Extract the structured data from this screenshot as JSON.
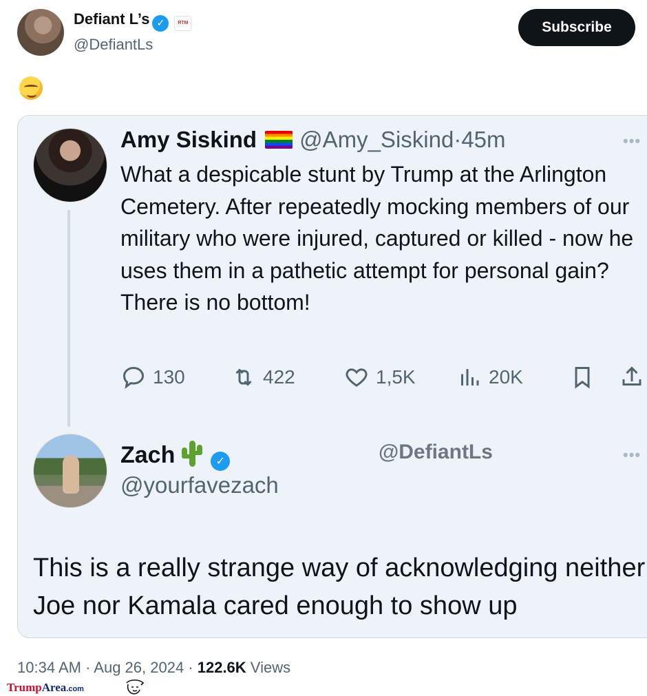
{
  "author": {
    "name": "Defiant L’s",
    "handle": "@DefiantLs",
    "badge": "RTM",
    "subscribe_label": "Subscribe",
    "tweet_emoji": "smirking-face-icon"
  },
  "quoted_tweet": {
    "name": "Amy Siskind",
    "flag_icon": "rainbow-flag-icon",
    "handle": "@Amy_Siskind",
    "separator": "·",
    "time": "45m",
    "text": "What a despicable stunt by Trump at the Arlington Cemetery. After repeatedly mocking members of our military who were injured, captured or killed - now he uses them in a pathetic attempt for personal gain? There is no bottom!",
    "stats": {
      "replies": "130",
      "retweets": "422",
      "likes": "1,5K",
      "views": "20K"
    }
  },
  "reply_tweet": {
    "name": "Zach",
    "emoji": "cactus-icon",
    "handle": "@yourfavezach",
    "overlay_handle": "@DefiantLs",
    "text": "This is a really strange way of acknowledging neither Joe nor Kamala cared enough to show up"
  },
  "footer": {
    "timestamp": "10:34 AM · Aug 26, 2024 · ",
    "views_count": "122.6K",
    "views_label": " Views"
  },
  "watermark": {
    "part1": "Trump",
    "part2": "Area",
    "part3": ".com"
  },
  "colors": {
    "accent": "#1d9bf0",
    "text_primary": "#0f1419",
    "text_secondary": "#536471",
    "card_bg": "#eef3fa"
  }
}
